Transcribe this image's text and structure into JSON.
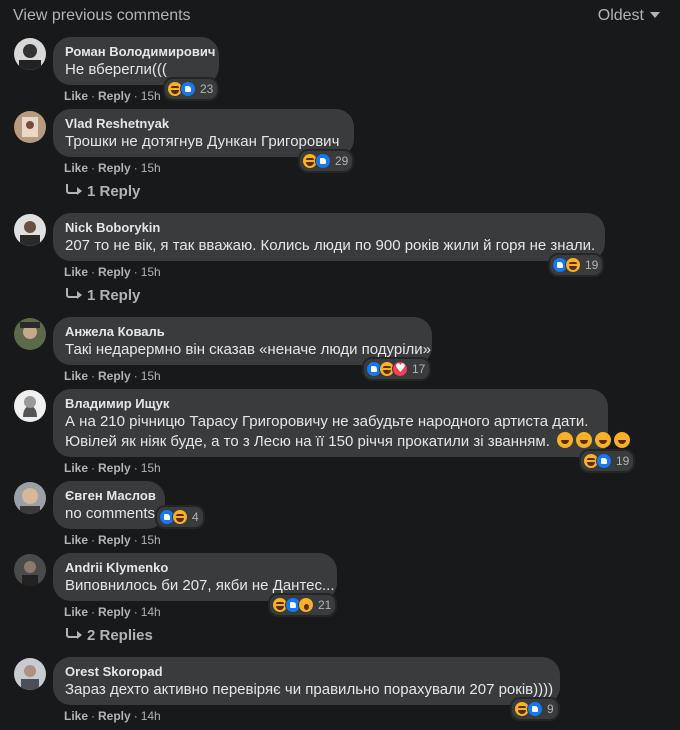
{
  "header": {
    "view_previous": "View previous comments",
    "sort_label": "Oldest"
  },
  "comments": [
    {
      "author": "Роман Володимирович",
      "lines": [
        "Не вберегли((("
      ],
      "like": "Like",
      "reply": "Reply",
      "time": "15h",
      "reactions": [
        "haha",
        "like"
      ],
      "count": "23"
    },
    {
      "author": "Vlad Reshetnyak",
      "lines": [
        "Трошки не дотягнув Дункан Григорович"
      ],
      "like": "Like",
      "reply": "Reply",
      "time": "15h",
      "reactions": [
        "haha",
        "like"
      ],
      "count": "29",
      "replies": "1 Reply"
    },
    {
      "author": "Nick Boborykin",
      "lines": [
        "207 то не вік, я так вважаю. Колись люди по 900 років жили й горя не знали."
      ],
      "like": "Like",
      "reply": "Reply",
      "time": "15h",
      "reactions": [
        "like",
        "haha"
      ],
      "count": "19",
      "replies": "1 Reply"
    },
    {
      "author": "Анжела Коваль",
      "lines": [
        "Такі недарермно він сказав «неначе люди подуріли»"
      ],
      "like": "Like",
      "reply": "Reply",
      "time": "15h",
      "reactions": [
        "like",
        "haha",
        "love"
      ],
      "count": "17"
    },
    {
      "author": "Владимир Ищук",
      "lines": [
        "А на 210 річницю Тарасу Григоровичу не забудьте народного артиста дати.",
        "Ювілей як ніяк буде, а то з Лесю на її 150 річчя прокатили зі званням."
      ],
      "like": "Like",
      "reply": "Reply",
      "time": "15h",
      "reactions": [
        "haha",
        "like"
      ],
      "count": "19"
    },
    {
      "author": "Євген Маслов",
      "lines": [
        "no comments"
      ],
      "like": "Like",
      "reply": "Reply",
      "time": "15h",
      "reactions": [
        "like",
        "haha"
      ],
      "count": "4"
    },
    {
      "author": "Andrii Klymenko",
      "lines": [
        "Виповнилось би 207, якби не Дантес..."
      ],
      "like": "Like",
      "reply": "Reply",
      "time": "14h",
      "reactions": [
        "haha",
        "like",
        "wow"
      ],
      "count": "21",
      "replies": "2 Replies"
    },
    {
      "author": "Orest Skoropad",
      "lines": [
        "Зараз дехто активно перевіряє чи правильно порахували 207 років))))"
      ],
      "like": "Like",
      "reply": "Reply",
      "time": "14h",
      "reactions": [
        "haha",
        "like"
      ],
      "count": "9"
    }
  ],
  "colors": {
    "background": "#18191a",
    "bubble": "#3a3b3c",
    "text": "#e4e6eb",
    "muted": "#b0b3b8",
    "like": "#1877f2",
    "haha": "#f7b125",
    "love": "#f33e58"
  },
  "icons": {
    "sort": "caret-down-icon",
    "reply_thread": "reply-arrow-icon"
  }
}
